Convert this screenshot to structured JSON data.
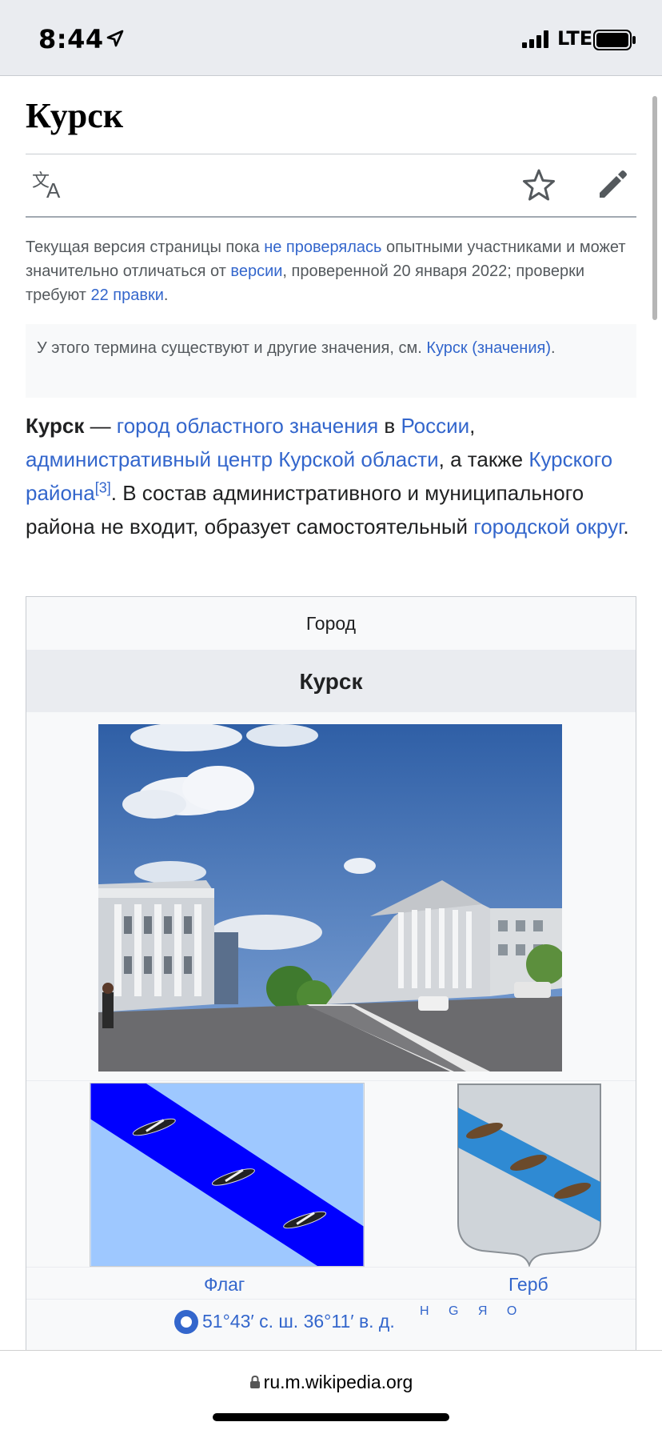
{
  "status_bar": {
    "time": "8:44",
    "network": "LTE"
  },
  "article": {
    "title": "Курск",
    "review_notice": {
      "t1": "Текущая версия страницы пока ",
      "link1": "не проверялась",
      "t2": " опытными участниками и может значительно отличаться от ",
      "link2": "версии",
      "t3": ", проверенной 20 января 2022; проверки требуют ",
      "link3": "22 правки",
      "t4": "."
    },
    "hatnote": {
      "text": "У этого термина существуют и другие значения, см. ",
      "link": "Курск (значения)",
      "end": "."
    },
    "lead": {
      "bold": "Курск",
      "t1": " — ",
      "link1": "город областного значения",
      "t2": " в ",
      "link2": "России",
      "t3": ", ",
      "link3": "административный центр Курской области",
      "t4": ", а также ",
      "link4": "Курского района",
      "ref": "[3]",
      "t5": ". В состав административного и муниципального района не входит, образует самостоятельный ",
      "link5": "городской округ",
      "t6": "."
    }
  },
  "infobox": {
    "type": "Город",
    "name": "Курск",
    "flag_caption": "Флаг",
    "coa_caption": "Герб",
    "coordinates": "51°43′ с. ш. 36°11′ в. д.",
    "map_links": "H G Я O"
  },
  "toolbar": {
    "icons": [
      "language-icon",
      "star-icon",
      "edit-pencil-icon"
    ]
  },
  "browser": {
    "url": "ru.m.wikipedia.org"
  },
  "colors": {
    "link": "#3366cc",
    "text": "#202122",
    "muted": "#54595d",
    "infobox_bg": "#f8f9fa",
    "header_bg": "#eaecf0"
  }
}
